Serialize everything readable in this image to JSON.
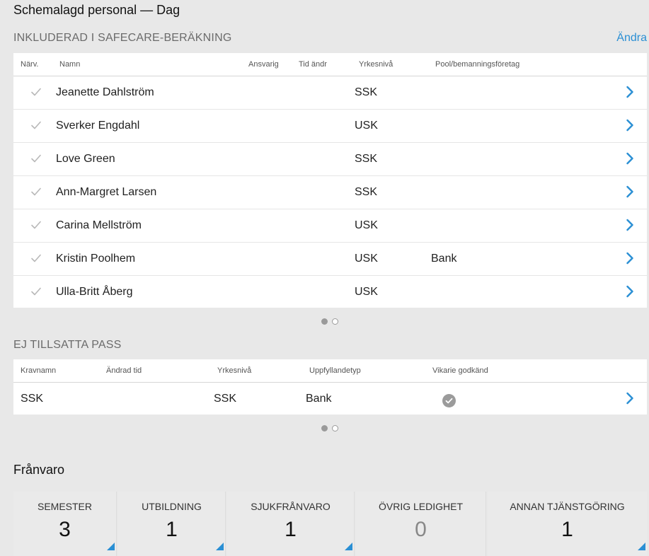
{
  "page_title": "Schemalagd personal — Dag",
  "included": {
    "title": "INKLUDERAD I SAFECARE-BERÄKNING",
    "edit_label": "Ändra",
    "headers": {
      "presence": "Närv.",
      "name": "Namn",
      "responsible": "Ansvarig",
      "time_changed": "Tid ändr",
      "level": "Yrkesnivå",
      "pool": "Pool/bemanningsföretag"
    },
    "rows": [
      {
        "name": "Jeanette Dahlström",
        "level": "SSK",
        "pool": ""
      },
      {
        "name": "Sverker Engdahl",
        "level": "USK",
        "pool": ""
      },
      {
        "name": "Love Green",
        "level": "SSK",
        "pool": ""
      },
      {
        "name": "Ann-Margret Larsen",
        "level": "SSK",
        "pool": ""
      },
      {
        "name": "Carina Mellström",
        "level": "USK",
        "pool": ""
      },
      {
        "name": "Kristin Poolhem",
        "level": "USK",
        "pool": "Bank"
      },
      {
        "name": "Ulla-Britt Åberg",
        "level": "USK",
        "pool": ""
      }
    ]
  },
  "unfilled": {
    "title": "EJ TILLSATTA PASS",
    "headers": {
      "req_name": "Kravnamn",
      "changed_time": "Ändrad tid",
      "level": "Yrkesnivå",
      "fulfillment": "Uppfyllandetyp",
      "sub_approved": "Vikarie godkänd"
    },
    "rows": [
      {
        "req_name": "SSK",
        "level": "SSK",
        "fulfillment": "Bank",
        "sub_approved": true
      }
    ]
  },
  "absence": {
    "title": "Frånvaro",
    "tiles": [
      {
        "label": "SEMESTER",
        "value": "3"
      },
      {
        "label": "UTBILDNING",
        "value": "1"
      },
      {
        "label": "SJUKFRÅNVARO",
        "value": "1"
      },
      {
        "label": "ÖVRIG LEDIGHET",
        "value": "0"
      },
      {
        "label": "ANNAN TJÄNSTGÖRING",
        "value": "1"
      }
    ]
  },
  "colors": {
    "accent": "#2a8fd4",
    "check": "#b8b8b8"
  }
}
